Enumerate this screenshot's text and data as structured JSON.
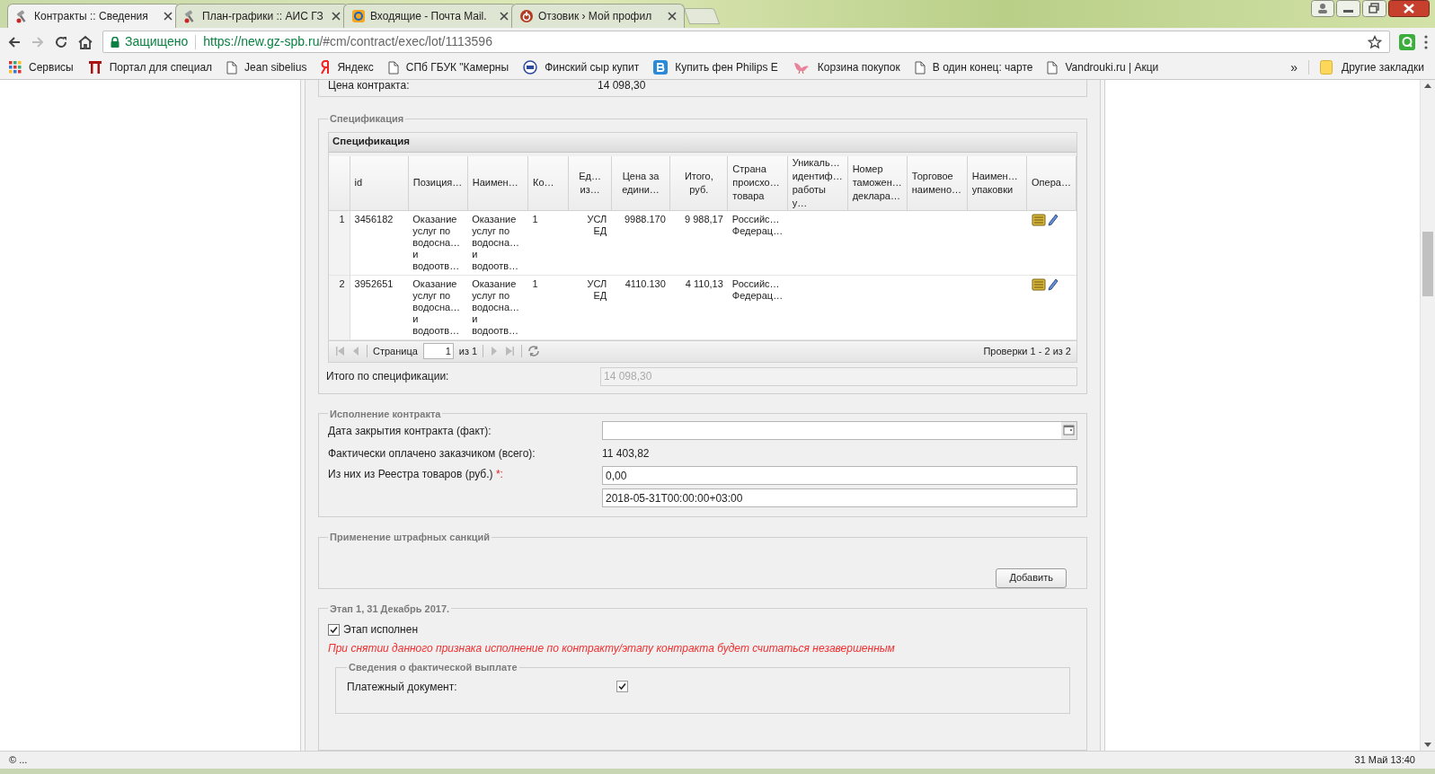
{
  "browser": {
    "tabs": [
      {
        "title": "Контракты :: Сведения",
        "selected": true
      },
      {
        "title": "План-графики :: АИС ГЗ",
        "selected": false
      },
      {
        "title": "Входящие - Почта Mail.",
        "selected": false
      },
      {
        "title": "Отзовик › Мой профил",
        "selected": false
      }
    ],
    "address": {
      "secure_label": "Защищено",
      "url_host": "https://new.gz-spb.ru",
      "url_path": "/#cm/contract/exec/lot/1113596"
    },
    "bookmarks": [
      {
        "title": "Сервисы"
      },
      {
        "title": "Портал для специал"
      },
      {
        "title": "Jean sibelius"
      },
      {
        "title": "Яндекс"
      },
      {
        "title": "СПб ГБУК \"Камерны"
      },
      {
        "title": "Финский сыр купит"
      },
      {
        "title": "Купить фен Philips E"
      },
      {
        "title": "Корзина покупок"
      },
      {
        "title": "В один конец: чарте"
      },
      {
        "title": "Vandrouki.ru | Акци"
      }
    ],
    "more": "»",
    "other_bookmarks": "Другие закладки"
  },
  "contract_price": {
    "label": "Цена контракта:",
    "value": "14 098,30"
  },
  "specification": {
    "legend": "Спецификация",
    "grid_title": "Спецификация",
    "columns": [
      {
        "kind": "num"
      },
      {
        "label": "id",
        "kind": "text"
      },
      {
        "label": "Позиция…",
        "kind": "text"
      },
      {
        "label": "Наимен…",
        "kind": "text"
      },
      {
        "label": "Ко…",
        "kind": "text"
      },
      {
        "label": "Ед…\nиз…",
        "kind": "center"
      },
      {
        "label": "Цена за\nедини…",
        "kind": "center"
      },
      {
        "label": "Итого,\nруб.",
        "kind": "center"
      },
      {
        "label": "Страна\nпроисхо…\nтовара",
        "kind": "text"
      },
      {
        "label": "Уникаль…\nидентиф…\nработы у…",
        "kind": "text"
      },
      {
        "label": "Номер\nтаможен…\nдеклара…",
        "kind": "text"
      },
      {
        "label": "Торговое\nнаимено…",
        "kind": "text"
      },
      {
        "label": "Наимен…\nупаковки",
        "kind": "text"
      },
      {
        "label": "Опера…",
        "kind": "ops"
      }
    ],
    "rows": [
      {
        "cells": [
          "1",
          "3456182",
          "Оказание\nуслуг по\nводосна…\nи\nводоотв…",
          "Оказание\nуслуг по\nводосна…\nи\nводоотв…",
          "1",
          "УСЛ\nЕД",
          "9988.170",
          "9 988,17",
          "Российс…\nФедерац…"
        ]
      },
      {
        "cells": [
          "2",
          "3952651",
          "Оказание\nуслуг по\nводосна…\nи\nводоотв…",
          "Оказание\nуслуг по\nводосна…\nи\nводоотв…",
          "1",
          "УСЛ\nЕД",
          "4110.130",
          "4 110,13",
          "Российс…\nФедерац…"
        ]
      }
    ],
    "pager": {
      "page_label": "Страница",
      "page": "1",
      "of": "из 1",
      "summary": "Проверки 1 - 2 из 2"
    },
    "total": {
      "label": "Итого по спецификации:",
      "value": "14 098,30",
      "disabled": true
    }
  },
  "execution": {
    "legend": "Исполнение контракта",
    "close_date": {
      "label": "Дата закрытия контракта (факт):"
    },
    "paid": {
      "label": "Фактически оплачено заказчиком (всего):",
      "value": "11 403,82"
    },
    "registry": {
      "label": "Из них из Реестра товаров (руб.) ",
      "required": "*:",
      "value": "0,00"
    },
    "date_value": "2018-05-31T00:00:00+03:00"
  },
  "sanctions": {
    "legend": "Применение штрафных санкций",
    "button": "Добавить"
  },
  "stage": {
    "legend": "Этап 1, 31 Декабрь 2017.",
    "done": {
      "label": "Этап исполнен",
      "checked": true
    },
    "warning": "При снятии данного признака исполнение по контракту/этапу контракта будет считаться незавершенным",
    "payment": {
      "legend": "Сведения о фактической выплате",
      "label": "Платежный документ:",
      "checked": true
    }
  },
  "status_bar": {
    "left": "© ...",
    "right": "31 Май 13:40"
  }
}
